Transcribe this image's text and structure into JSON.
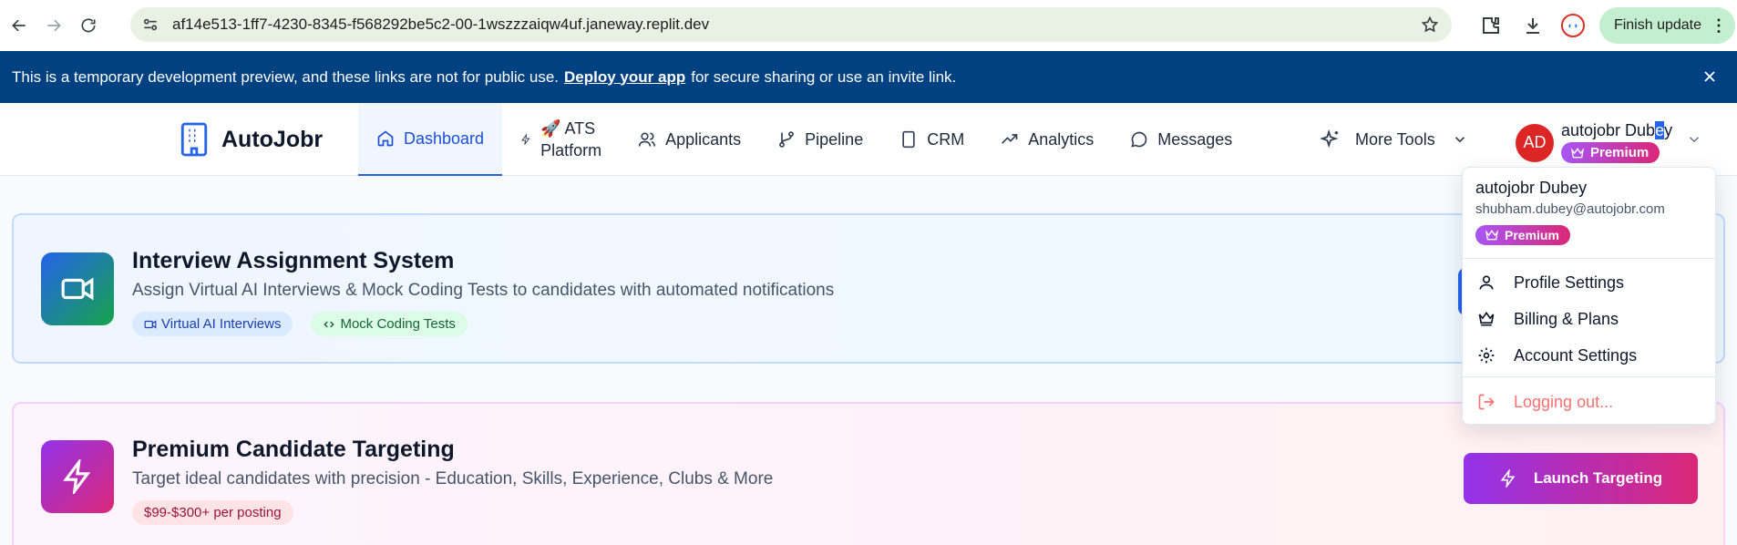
{
  "browser": {
    "url": "af14e513-1ff7-4230-8345-f568292be5c2-00-1wszzzaiqw4uf.janeway.replit.dev",
    "finish_update_label": "Finish update"
  },
  "banner": {
    "text_before": "This is a temporary development preview, and these links are not for public use.",
    "link": "Deploy your app",
    "text_after": "for secure sharing or use an invite link."
  },
  "app": {
    "name": "AutoJobr"
  },
  "nav": {
    "dashboard": "Dashboard",
    "ats_line1": "🚀 ATS",
    "ats_line2": "Platform",
    "applicants": "Applicants",
    "pipeline": "Pipeline",
    "crm": "CRM",
    "analytics": "Analytics",
    "messages": "Messages",
    "more_tools": "More Tools"
  },
  "user": {
    "initials": "AD",
    "name_part1": "autojobr Dub",
    "name_selected": "e",
    "name_part2": "y",
    "badge": "Premium"
  },
  "dropdown": {
    "name": "autojobr Dubey",
    "email": "shubham.dubey@autojobr.com",
    "badge": "Premium",
    "profile_settings": "Profile Settings",
    "billing_plans": "Billing & Plans",
    "account_settings": "Account Settings",
    "logging_out": "Logging out..."
  },
  "cards": {
    "interview": {
      "title": "Interview Assignment System",
      "description": "Assign Virtual AI Interviews & Mock Coding Tests to candidates with automated notifications",
      "tag1": "Virtual AI Interviews",
      "tag2": "Mock Coding Tests"
    },
    "targeting": {
      "title": "Premium Candidate Targeting",
      "description": "Target ideal candidates with precision - Education, Skills, Experience, Clubs & More",
      "tag1": "$99-$300+ per posting",
      "button": "Launch Targeting"
    }
  },
  "colors": {
    "banner": "#004182",
    "primary": "#2563eb",
    "premium_gradient_start": "#a855f7",
    "premium_gradient_end": "#db2777",
    "avatar": "#dc2626"
  }
}
